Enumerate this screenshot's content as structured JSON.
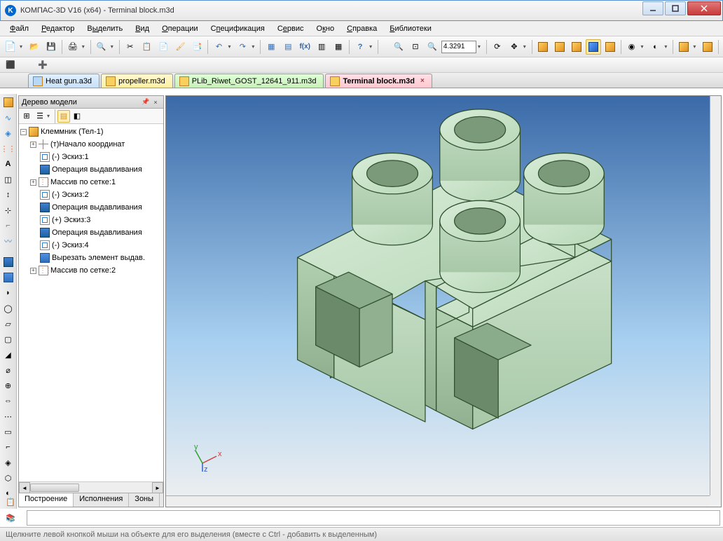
{
  "window": {
    "title": "КОМПАС-3D V16  (x64) - Terminal block.m3d"
  },
  "menu": [
    "Файл",
    "Редактор",
    "Выделить",
    "Вид",
    "Операции",
    "Спецификация",
    "Сервис",
    "Окно",
    "Справка",
    "Библиотеки"
  ],
  "toolbar": {
    "zoom_value": "4.3291"
  },
  "tabs": [
    {
      "label": "Heat gun.a3d",
      "color": "blue"
    },
    {
      "label": "propeller.m3d",
      "color": "yellow"
    },
    {
      "label": "PLib_Riwet_GOST_12641_911.m3d",
      "color": "green"
    },
    {
      "label": "Terminal block.m3d",
      "color": "pink",
      "active": true
    }
  ],
  "panel": {
    "title": "Дерево модели",
    "root": "Клеммник (Тел-1)",
    "items": [
      {
        "exp": "+",
        "icon": "origin",
        "label": "(т)Начало координат",
        "indent": 1
      },
      {
        "exp": "",
        "icon": "sketch",
        "label": "(-) Эскиз:1",
        "indent": 1
      },
      {
        "exp": "",
        "icon": "extrude",
        "label": "Операция выдавливания",
        "indent": 1
      },
      {
        "exp": "+",
        "icon": "array",
        "label": "Массив по сетке:1",
        "indent": 1
      },
      {
        "exp": "",
        "icon": "sketch",
        "label": "(-) Эскиз:2",
        "indent": 1
      },
      {
        "exp": "",
        "icon": "extrude",
        "label": "Операция выдавливания",
        "indent": 1
      },
      {
        "exp": "",
        "icon": "sketch",
        "label": "(+) Эскиз:3",
        "indent": 1
      },
      {
        "exp": "",
        "icon": "extrude",
        "label": "Операция выдавливания",
        "indent": 1
      },
      {
        "exp": "",
        "icon": "sketch",
        "label": "(-) Эскиз:4",
        "indent": 1
      },
      {
        "exp": "",
        "icon": "cut",
        "label": "Вырезать элемент выдав.",
        "indent": 1
      },
      {
        "exp": "+",
        "icon": "array",
        "label": "Массив по сетке:2",
        "indent": 1
      }
    ],
    "bottom_tabs": [
      "Построение",
      "Исполнения",
      "Зоны"
    ]
  },
  "statusbar": {
    "text": "Щелкните левой кнопкой мыши на объекте для его выделения (вместе с Ctrl - добавить к выделенным)"
  }
}
